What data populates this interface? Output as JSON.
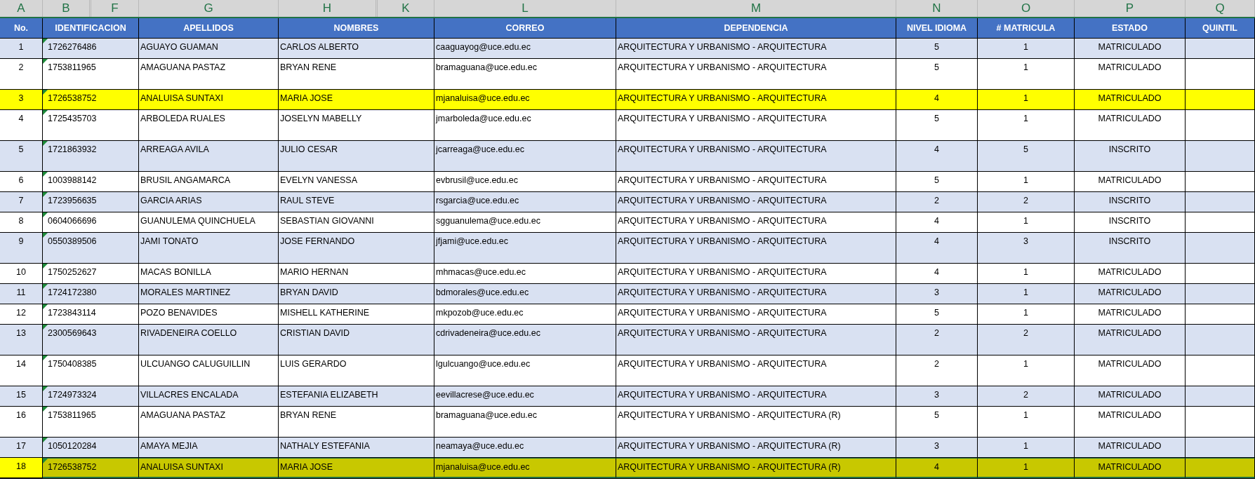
{
  "column_letters": [
    {
      "letter": "A"
    },
    {
      "letter": "B"
    },
    {
      "letter": "F"
    },
    {
      "letter": "G"
    },
    {
      "letter": "H"
    },
    {
      "letter": "K"
    },
    {
      "letter": "L"
    },
    {
      "letter": "M"
    },
    {
      "letter": "N"
    },
    {
      "letter": "O"
    },
    {
      "letter": "P"
    },
    {
      "letter": "Q"
    }
  ],
  "table": {
    "columns": [
      "No.",
      "IDENTIFICACION",
      "APELLIDOS",
      "NOMBRES",
      "CORREO",
      "DEPENDENCIA",
      "NIVEL IDIOMA",
      "# MATRICULA",
      "ESTADO",
      "QUINTIL"
    ],
    "rows": [
      {
        "no": "1",
        "id": "1726276486",
        "apellidos": "AGUAYO GUAMAN",
        "nombres": "CARLOS ALBERTO",
        "correo": "caaguayog@uce.edu.ec",
        "dependencia": "ARQUITECTURA Y URBANISMO - ARQUITECTURA",
        "nivel": "5",
        "matricula": "1",
        "estado": "MATRICULADO",
        "highlighted": false,
        "selected": false
      },
      {
        "no": "2",
        "id": "1753811965",
        "apellidos": "AMAGUANA PASTAZ",
        "nombres": "BRYAN RENE",
        "correo": "bramaguana@uce.edu.ec",
        "dependencia": "ARQUITECTURA Y URBANISMO - ARQUITECTURA",
        "nivel": "5",
        "matricula": "1",
        "estado": "MATRICULADO",
        "highlighted": false,
        "selected": false
      },
      {
        "no": "3",
        "id": "1726538752",
        "apellidos": "ANALUISA SUNTAXI",
        "nombres": "MARIA JOSE",
        "correo": "mjanaluisa@uce.edu.ec",
        "dependencia": "ARQUITECTURA Y URBANISMO - ARQUITECTURA",
        "nivel": "4",
        "matricula": "1",
        "estado": "MATRICULADO",
        "highlighted": true,
        "selected": false
      },
      {
        "no": "4",
        "id": "1725435703",
        "apellidos": "ARBOLEDA RUALES",
        "nombres": "JOSELYN MABELLY",
        "correo": "jmarboleda@uce.edu.ec",
        "dependencia": "ARQUITECTURA Y URBANISMO - ARQUITECTURA",
        "nivel": "5",
        "matricula": "1",
        "estado": "MATRICULADO",
        "highlighted": false,
        "selected": false
      },
      {
        "no": "5",
        "id": "1721863932",
        "apellidos": "ARREAGA AVILA",
        "nombres": "JULIO CESAR",
        "correo": "jcarreaga@uce.edu.ec",
        "dependencia": "ARQUITECTURA Y URBANISMO - ARQUITECTURA",
        "nivel": "4",
        "matricula": "5",
        "estado": "INSCRITO",
        "highlighted": false,
        "selected": false
      },
      {
        "no": "6",
        "id": "1003988142",
        "apellidos": "BRUSIL ANGAMARCA",
        "nombres": "EVELYN VANESSA",
        "correo": "evbrusil@uce.edu.ec",
        "dependencia": "ARQUITECTURA Y URBANISMO - ARQUITECTURA",
        "nivel": "5",
        "matricula": "1",
        "estado": "MATRICULADO",
        "highlighted": false,
        "selected": false
      },
      {
        "no": "7",
        "id": "1723956635",
        "apellidos": "GARCIA ARIAS",
        "nombres": "RAUL STEVE",
        "correo": "rsgarcia@uce.edu.ec",
        "dependencia": "ARQUITECTURA Y URBANISMO - ARQUITECTURA",
        "nivel": "2",
        "matricula": "2",
        "estado": "INSCRITO",
        "highlighted": false,
        "selected": false
      },
      {
        "no": "8",
        "id": "0604066696",
        "apellidos": "GUANULEMA QUINCHUELA",
        "nombres": "SEBASTIAN GIOVANNI",
        "correo": "sgguanulema@uce.edu.ec",
        "dependencia": "ARQUITECTURA Y URBANISMO - ARQUITECTURA",
        "nivel": "4",
        "matricula": "1",
        "estado": "INSCRITO",
        "highlighted": false,
        "selected": false
      },
      {
        "no": "9",
        "id": "0550389506",
        "apellidos": "JAMI TONATO",
        "nombres": "JOSE FERNANDO",
        "correo": "jfjami@uce.edu.ec",
        "dependencia": "ARQUITECTURA Y URBANISMO - ARQUITECTURA",
        "nivel": "4",
        "matricula": "3",
        "estado": "INSCRITO",
        "highlighted": false,
        "selected": false
      },
      {
        "no": "10",
        "id": "1750252627",
        "apellidos": "MACAS BONILLA",
        "nombres": "MARIO HERNAN",
        "correo": "mhmacas@uce.edu.ec",
        "dependencia": "ARQUITECTURA Y URBANISMO - ARQUITECTURA",
        "nivel": "4",
        "matricula": "1",
        "estado": "MATRICULADO",
        "highlighted": false,
        "selected": false
      },
      {
        "no": "11",
        "id": "1724172380",
        "apellidos": "MORALES MARTINEZ",
        "nombres": "BRYAN DAVID",
        "correo": "bdmorales@uce.edu.ec",
        "dependencia": "ARQUITECTURA Y URBANISMO - ARQUITECTURA",
        "nivel": "3",
        "matricula": "1",
        "estado": "MATRICULADO",
        "highlighted": false,
        "selected": false
      },
      {
        "no": "12",
        "id": "1723843114",
        "apellidos": "POZO BENAVIDES",
        "nombres": "MISHELL KATHERINE",
        "correo": "mkpozob@uce.edu.ec",
        "dependencia": "ARQUITECTURA Y URBANISMO - ARQUITECTURA",
        "nivel": "5",
        "matricula": "1",
        "estado": "MATRICULADO",
        "highlighted": false,
        "selected": false
      },
      {
        "no": "13",
        "id": "2300569643",
        "apellidos": "RIVADENEIRA COELLO",
        "nombres": "CRISTIAN DAVID",
        "correo": "cdrivadeneira@uce.edu.ec",
        "dependencia": "ARQUITECTURA Y URBANISMO - ARQUITECTURA",
        "nivel": "2",
        "matricula": "2",
        "estado": "MATRICULADO",
        "highlighted": false,
        "selected": false
      },
      {
        "no": "14",
        "id": "1750408385",
        "apellidos": "ULCUANGO CALUGUILLIN",
        "nombres": "LUIS GERARDO",
        "correo": "lgulcuango@uce.edu.ec",
        "dependencia": "ARQUITECTURA Y URBANISMO - ARQUITECTURA",
        "nivel": "2",
        "matricula": "1",
        "estado": "MATRICULADO",
        "highlighted": false,
        "selected": false
      },
      {
        "no": "15",
        "id": "1724973324",
        "apellidos": "VILLACRES ENCALADA",
        "nombres": "ESTEFANIA ELIZABETH",
        "correo": "eevillacrese@uce.edu.ec",
        "dependencia": "ARQUITECTURA Y URBANISMO - ARQUITECTURA",
        "nivel": "3",
        "matricula": "2",
        "estado": "MATRICULADO",
        "highlighted": false,
        "selected": false
      },
      {
        "no": "16",
        "id": "1753811965",
        "apellidos": "AMAGUANA PASTAZ",
        "nombres": "BRYAN RENE",
        "correo": "bramaguana@uce.edu.ec",
        "dependencia": "ARQUITECTURA Y URBANISMO - ARQUITECTURA (R)",
        "nivel": "5",
        "matricula": "1",
        "estado": "MATRICULADO",
        "highlighted": false,
        "selected": false
      },
      {
        "no": "17",
        "id": "1050120284",
        "apellidos": "AMAYA MEJIA",
        "nombres": "NATHALY ESTEFANIA",
        "correo": "neamaya@uce.edu.ec",
        "dependencia": "ARQUITECTURA Y URBANISMO - ARQUITECTURA (R)",
        "nivel": "3",
        "matricula": "1",
        "estado": "MATRICULADO",
        "highlighted": false,
        "selected": false
      },
      {
        "no": "18",
        "id": "1726538752",
        "apellidos": "ANALUISA SUNTAXI",
        "nombres": "MARIA JOSE",
        "correo": "mjanaluisa@uce.edu.ec",
        "dependencia": "ARQUITECTURA Y URBANISMO - ARQUITECTURA (R)",
        "nivel": "4",
        "matricula": "1",
        "estado": "MATRICULADO",
        "highlighted": true,
        "selected": true
      }
    ]
  }
}
